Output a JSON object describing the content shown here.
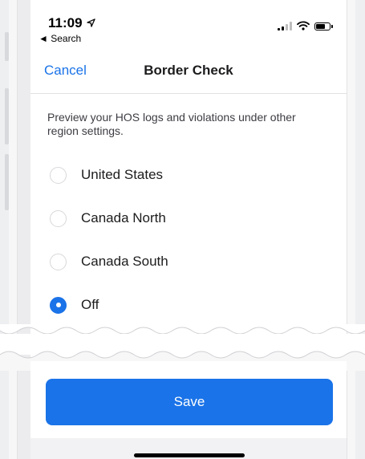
{
  "status_bar": {
    "time": "11:09",
    "back_label": "◄ Search"
  },
  "nav": {
    "cancel_label": "Cancel",
    "title": "Border Check"
  },
  "description": "Preview your HOS logs and violations under other region settings.",
  "options": [
    {
      "label": "United States",
      "selected": false
    },
    {
      "label": "Canada North",
      "selected": false
    },
    {
      "label": "Canada South",
      "selected": false
    },
    {
      "label": "Off",
      "selected": true
    }
  ],
  "save_label": "Save",
  "colors": {
    "accent": "#1a73e8",
    "text": "#1c1c1e",
    "radio_border": "#d8d8dc"
  }
}
